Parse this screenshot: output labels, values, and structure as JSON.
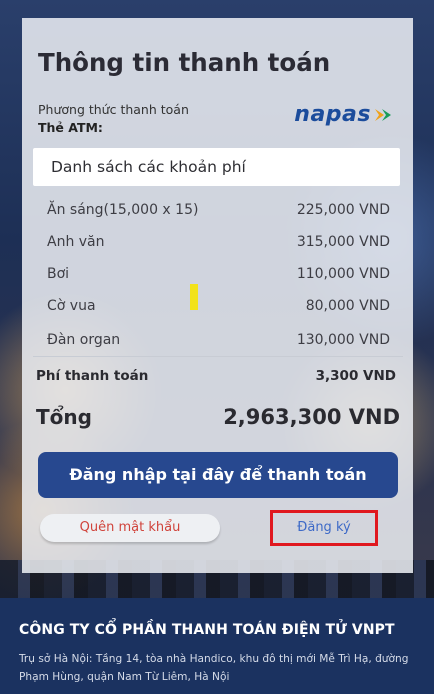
{
  "payment": {
    "title": "Thông tin thanh toán",
    "method_label": "Phương thức thanh toán",
    "method_value": "Thẻ ATM:",
    "provider_logo": "napas"
  },
  "fees": {
    "header": "Danh sách các khoản phí",
    "items": [
      {
        "name": "Ăn sáng(15,000 x 15)",
        "amount": "225,000 VND"
      },
      {
        "name": "Anh văn",
        "amount": "315,000 VND"
      },
      {
        "name": "Bơi",
        "amount": "110,000 VND"
      },
      {
        "name": "Cờ vua",
        "amount": "80,000 VND"
      },
      {
        "name": "Đàn organ",
        "amount": "130,000 VND"
      }
    ],
    "payment_fee_label": "Phí thanh toán",
    "payment_fee_value": "3,300 VND",
    "total_label": "Tổng",
    "total_value": "2,963,300 VND"
  },
  "actions": {
    "login_label": "Đăng nhập tại đây để thanh toán",
    "forgot_label": "Quên mật khẩu",
    "register_label": "Đăng ký"
  },
  "footer": {
    "company": "CÔNG TY CỔ PHẦN THANH TOÁN ĐIỆN TỬ VNPT",
    "address": "Trụ sở Hà Nội: Tầng 14, tòa nhà Handico, khu đô thị mới Mễ Trì Hạ, đường Phạm Hùng, quận Nam Từ Liêm, Hà Nội"
  },
  "colors": {
    "primary": "#27488f",
    "danger": "#d0433b",
    "link": "#3d6ac7",
    "highlight_box": "#e0181f",
    "footer_bg": "#1b3260"
  }
}
